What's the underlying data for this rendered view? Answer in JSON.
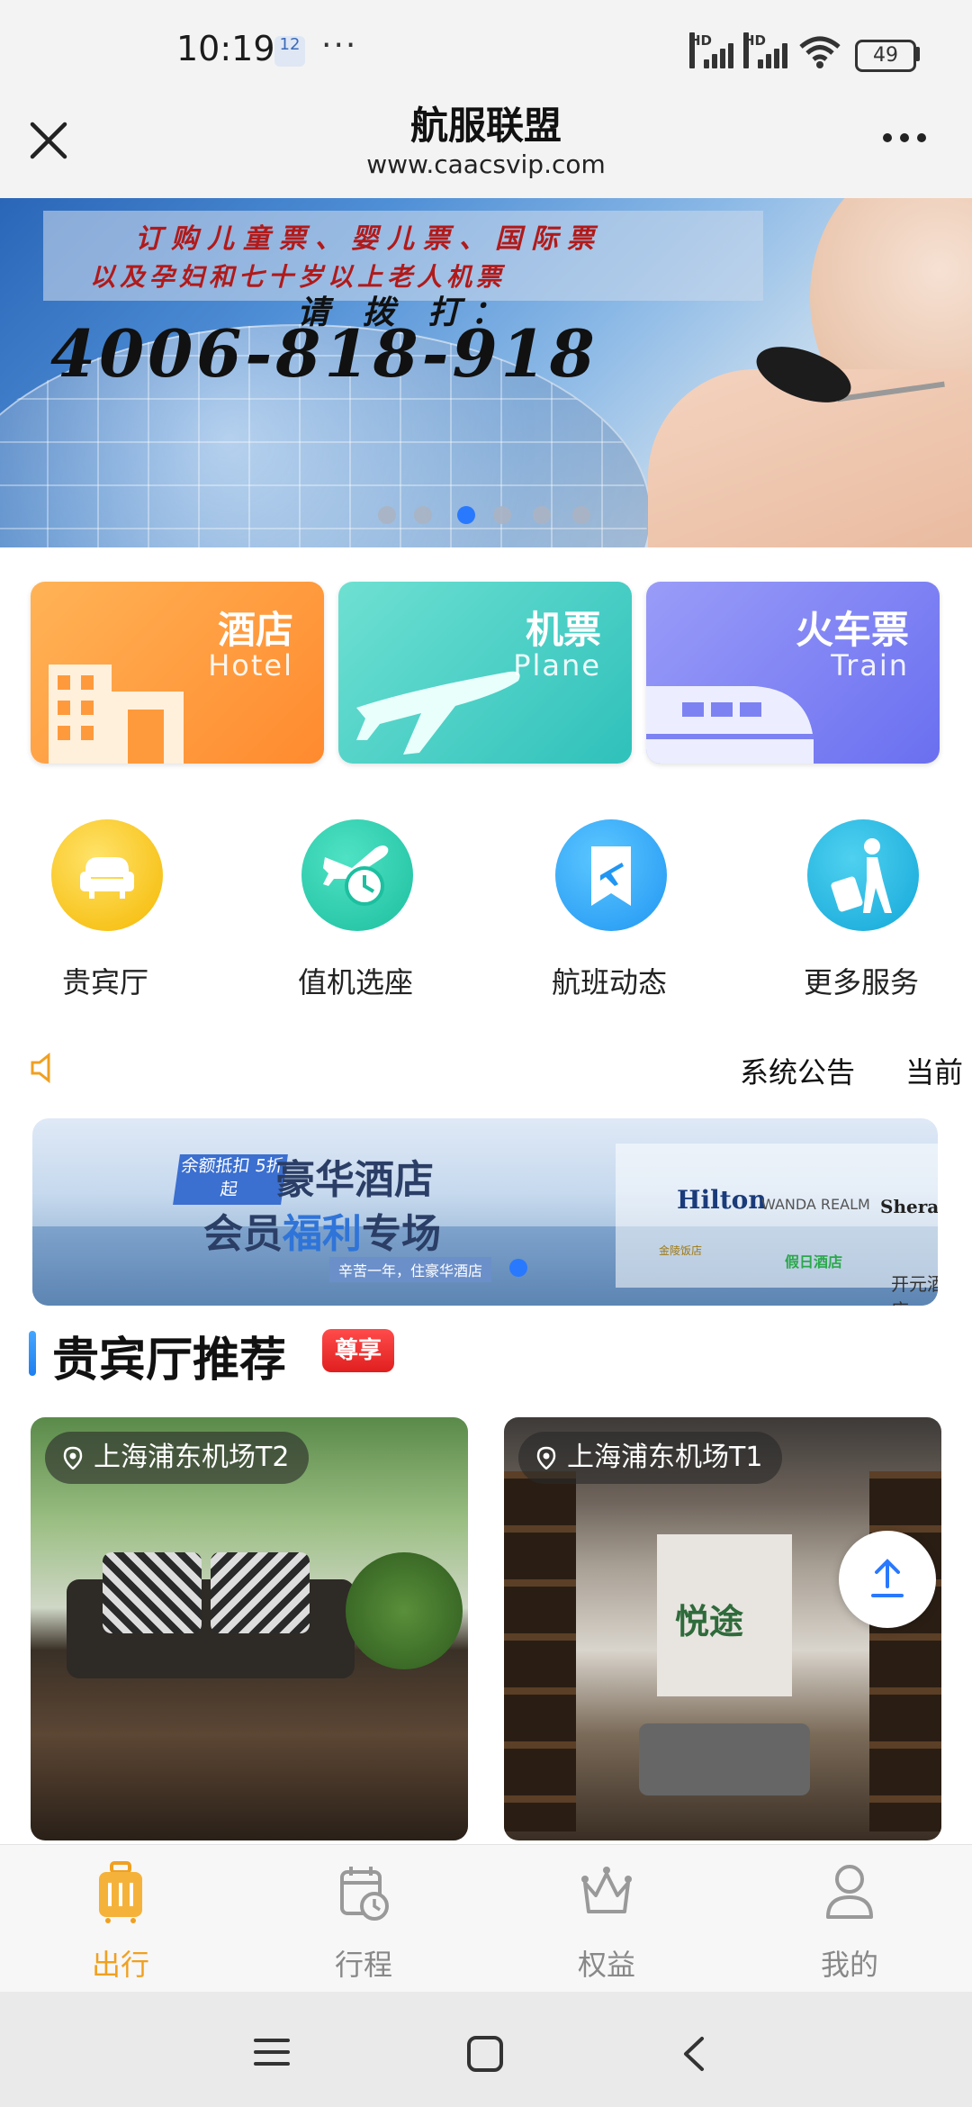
{
  "status_bar": {
    "time": "10:19",
    "notification_badge": "12",
    "overflow": "···",
    "network_1": "HD",
    "network_2": "HD",
    "battery": "49"
  },
  "header": {
    "title": "航服联盟",
    "url": "www.caacsvip.com",
    "close_icon": "close-icon",
    "more_icon": "more-dots-icon"
  },
  "banner": {
    "line1": "订购儿童票、婴儿票、国际票",
    "line2": "以及孕妇和七十岁以上老人机票",
    "line3": "请 拨 打：",
    "phone": "4006-818-918",
    "slide_count": 6,
    "active_slide": 3
  },
  "categories": [
    {
      "zh": "酒店",
      "en": "Hotel",
      "icon": "building-icon",
      "color": "#ff8a2e"
    },
    {
      "zh": "机票",
      "en": "Plane",
      "icon": "airplane-icon",
      "color": "#2fc1bb"
    },
    {
      "zh": "火车票",
      "en": "Train",
      "icon": "train-icon",
      "color": "#6a6ff0"
    }
  ],
  "services": [
    {
      "label": "贵宾厅",
      "icon": "sofa-icon"
    },
    {
      "label": "值机选座",
      "icon": "checkin-clock-icon"
    },
    {
      "label": "航班动态",
      "icon": "flight-bookmark-icon"
    },
    {
      "label": "更多服务",
      "icon": "traveler-icon"
    }
  ],
  "notice": {
    "icon": "speaker-icon",
    "items": [
      "系统公告",
      "当前"
    ]
  },
  "promo": {
    "tag": "余额抵扣 5折起",
    "title1": "豪华酒店",
    "title2_a": "会员",
    "title2_b": "福利",
    "title2_c": "专场",
    "subtitle": "辛苦一年，住豪华酒店",
    "logos": {
      "hilton": "Hilton",
      "wanda": "WANDA REALM",
      "sheraton": "Sheraton",
      "gold": "金陵饭店",
      "holiday": "假日酒店",
      "kaiyuan": "开元酒店"
    }
  },
  "section": {
    "title": "贵宾厅推荐",
    "badge": "尊享"
  },
  "lounges": [
    {
      "location": "上海浦东机场T2"
    },
    {
      "location": "上海浦东机场T1",
      "sign": "悦途"
    }
  ],
  "fab": {
    "icon": "upload-arrow-icon"
  },
  "tabbar": [
    {
      "label": "出行",
      "icon": "luggage-icon",
      "active": true
    },
    {
      "label": "行程",
      "icon": "calendar-clock-icon",
      "active": false
    },
    {
      "label": "权益",
      "icon": "crown-icon",
      "active": false
    },
    {
      "label": "我的",
      "icon": "user-icon",
      "active": false
    }
  ],
  "system_nav": {
    "menu": "menu-icon",
    "home": "home-square-icon",
    "back": "back-chevron-icon"
  },
  "colors": {
    "accent": "#f0a020",
    "link_blue": "#2979ff",
    "badge_red": "#e01f1f"
  }
}
